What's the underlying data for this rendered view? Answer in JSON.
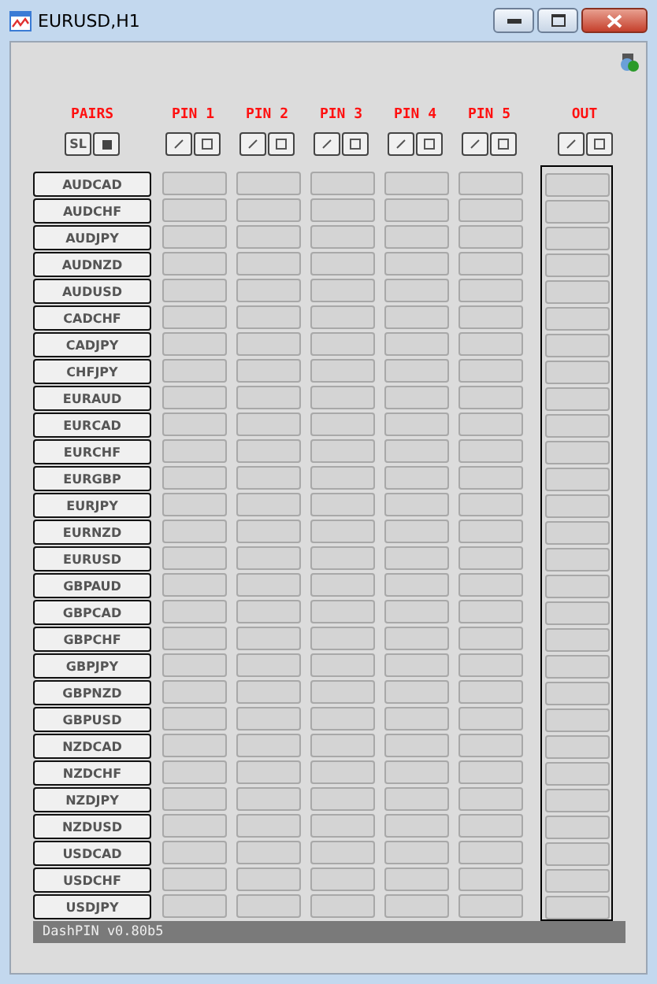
{
  "window": {
    "title": "EURUSD,H1"
  },
  "pairs_header": {
    "label": "PAIRS",
    "sl_button": "SL"
  },
  "pins": [
    {
      "label": "PIN 1"
    },
    {
      "label": "PIN 2"
    },
    {
      "label": "PIN 3"
    },
    {
      "label": "PIN 4"
    },
    {
      "label": "PIN 5"
    }
  ],
  "out_header": {
    "label": "OUT"
  },
  "pairs": [
    "AUDCAD",
    "AUDCHF",
    "AUDJPY",
    "AUDNZD",
    "AUDUSD",
    "CADCHF",
    "CADJPY",
    "CHFJPY",
    "EURAUD",
    "EURCAD",
    "EURCHF",
    "EURGBP",
    "EURJPY",
    "EURNZD",
    "EURUSD",
    "GBPAUD",
    "GBPCAD",
    "GBPCHF",
    "GBPJPY",
    "GBPNZD",
    "GBPUSD",
    "NZDCAD",
    "NZDCHF",
    "NZDJPY",
    "NZDUSD",
    "USDCAD",
    "USDCHF",
    "USDJPY"
  ],
  "status_bar": "DashPIN v0.80b5"
}
